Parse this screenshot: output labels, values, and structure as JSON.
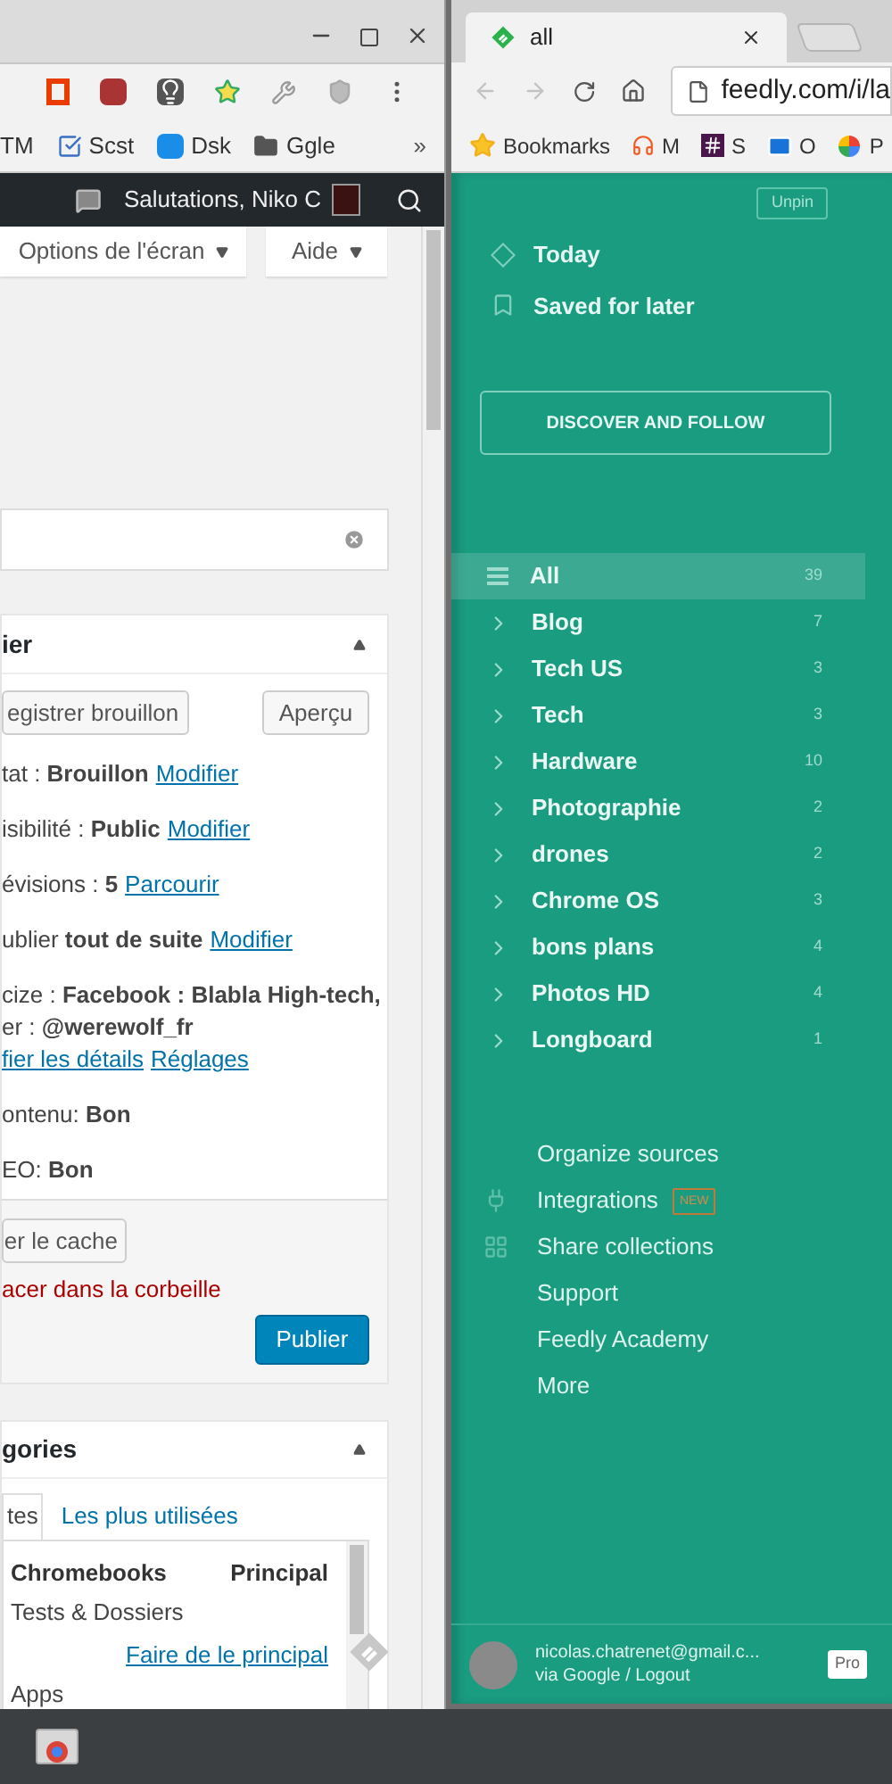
{
  "left_window": {
    "bookmarks": [
      {
        "label": "TM",
        "kind": "plain"
      },
      {
        "label": "Scst",
        "kind": "check"
      },
      {
        "label": "Dsk",
        "kind": "dsm"
      },
      {
        "label": "Ggle",
        "kind": "folder"
      }
    ],
    "bookmarks_more": "»",
    "admin_bar": {
      "greeting": "Salutations, Niko C"
    },
    "screen_buttons": [
      "Options de l'écran",
      "Aide"
    ],
    "publish_box": {
      "title": "ier",
      "buttons": [
        "egistrer brouillon",
        "Aperçu"
      ],
      "rows": [
        {
          "lines": [
            {
              "text": "tat : **Brouillon**",
              "links": [
                "Modifier"
              ]
            }
          ]
        },
        {
          "lines": [
            {
              "text": "isibilité : **Public**",
              "links": [
                "Modifier"
              ]
            }
          ]
        },
        {
          "lines": [
            {
              "text": "évisions : **5**",
              "links": [
                "Parcourir"
              ]
            }
          ]
        },
        {
          "lines": [
            {
              "text": "ublier **tout de suite**",
              "links": [
                "Modifier"
              ]
            }
          ]
        },
        {
          "lines": [
            {
              "text": "cize : **Facebook : Blabla High-tech,**"
            },
            {
              "text": "er : **@werewolf_fr**"
            },
            {
              "links": [
                "fier les détails",
                "Réglages"
              ]
            }
          ]
        },
        {
          "lines": [
            {
              "text": "ontenu: **Bon**"
            }
          ]
        },
        {
          "lines": [
            {
              "text": "EO: **Bon**"
            }
          ]
        }
      ],
      "cache_button": "er le cache",
      "trash_link": "acer dans la corbeille",
      "publish_button": "Publier"
    },
    "categories_box": {
      "title": "gories",
      "tabs": [
        {
          "label": "tes",
          "selected": true
        },
        {
          "label": "Les plus utilisées",
          "selected": false
        }
      ],
      "items": [
        {
          "name": "Chromebooks",
          "primary": true,
          "tag": "Principal"
        },
        {
          "name": "Tests & Dossiers",
          "primary": false,
          "action": "Faire de le principal"
        },
        {
          "name": "Apps",
          "primary": false
        }
      ]
    }
  },
  "right_window": {
    "tab_title": "all",
    "address": "feedly.com/i/la",
    "bookmarks": [
      {
        "label": "Bookmarks",
        "kind": "star"
      },
      {
        "label": "M",
        "kind": "headphones"
      },
      {
        "label": "S",
        "kind": "hash"
      },
      {
        "label": "O",
        "kind": "mail"
      },
      {
        "label": "P",
        "kind": "pinwheel"
      }
    ],
    "feedly": {
      "unpin": "Unpin",
      "nav": [
        {
          "label": "Today",
          "kind": "today"
        },
        {
          "label": "Saved for later",
          "kind": "saved"
        }
      ],
      "discover": "DISCOVER AND FOLLOW",
      "feeds": [
        {
          "label": "All",
          "count": "39",
          "selected": true
        },
        {
          "label": "Blog",
          "count": "7",
          "selected": false
        },
        {
          "label": "Tech US",
          "count": "3",
          "selected": false
        },
        {
          "label": "Tech",
          "count": "3",
          "selected": false
        },
        {
          "label": "Hardware",
          "count": "10",
          "selected": false
        },
        {
          "label": "Photographie",
          "count": "2",
          "selected": false
        },
        {
          "label": "drones",
          "count": "2",
          "selected": false
        },
        {
          "label": "Chrome OS",
          "count": "3",
          "selected": false
        },
        {
          "label": "bons plans",
          "count": "4",
          "selected": false
        },
        {
          "label": "Photos HD",
          "count": "4",
          "selected": false
        },
        {
          "label": "Longboard",
          "count": "1",
          "selected": false
        }
      ],
      "menu": [
        {
          "label": "Organize sources",
          "kind": "plain"
        },
        {
          "label": "Integrations",
          "kind": "plug",
          "badge": "NEW"
        },
        {
          "label": "Share collections",
          "kind": "share"
        },
        {
          "label": "Support",
          "kind": "plain"
        },
        {
          "label": "Feedly Academy",
          "kind": "plain"
        },
        {
          "label": "More",
          "kind": "plain"
        }
      ],
      "user": {
        "email": "nicolas.chatrenet@gmail.c...",
        "sub": "via Google / Logout",
        "plan": "Pro"
      }
    }
  }
}
